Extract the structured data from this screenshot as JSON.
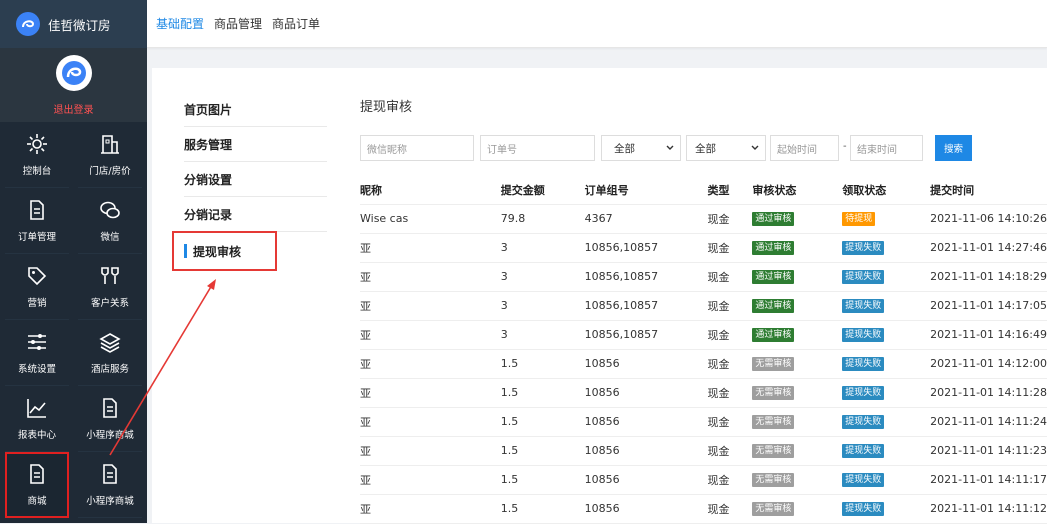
{
  "brand": {
    "name": "佳哲微订房"
  },
  "profile": {
    "logout_label": "退出登录"
  },
  "nav": [
    {
      "label": "控制台",
      "icon": "gear-icon"
    },
    {
      "label": "门店/房价",
      "icon": "building-icon"
    },
    {
      "label": "订单管理",
      "icon": "document-icon"
    },
    {
      "label": "微信",
      "icon": "wechat-icon"
    },
    {
      "label": "营销",
      "icon": "tag-icon"
    },
    {
      "label": "客户关系",
      "icon": "cups-icon"
    },
    {
      "label": "系统设置",
      "icon": "sliders-icon"
    },
    {
      "label": "酒店服务",
      "icon": "layers-icon"
    },
    {
      "label": "报表中心",
      "icon": "chart-icon"
    },
    {
      "label": "小程序商城",
      "icon": "document-icon"
    },
    {
      "label": "商城",
      "icon": "document-icon"
    },
    {
      "label": "小程序商城",
      "icon": "document-icon"
    }
  ],
  "tabs": [
    "基础配置",
    "商品管理",
    "商品订单"
  ],
  "submenu": [
    "首页图片",
    "服务管理",
    "分销设置",
    "分销记录",
    "提现审核"
  ],
  "page_title": "提现审核",
  "filters": {
    "nickname_placeholder": "微信昵称",
    "order_placeholder": "订单号",
    "select1": "全部",
    "select2": "全部",
    "start_placeholder": "起始时间",
    "dash": "-",
    "end_placeholder": "结束时间",
    "search_label": "搜索"
  },
  "table": {
    "headers": [
      "昵称",
      "提交金额",
      "订单组号",
      "类型",
      "审核状态",
      "领取状态",
      "提交时间"
    ],
    "rows": [
      [
        "Wise cas",
        "79.8",
        "4367",
        "现金",
        "通过审核",
        "待提现",
        "2021-11-06 14:10:26"
      ],
      [
        "亚",
        "3",
        "10856,10857",
        "现金",
        "通过审核",
        "提现失败",
        "2021-11-01 14:27:46"
      ],
      [
        "亚",
        "3",
        "10856,10857",
        "现金",
        "通过审核",
        "提现失败",
        "2021-11-01 14:18:29"
      ],
      [
        "亚",
        "3",
        "10856,10857",
        "现金",
        "通过审核",
        "提现失败",
        "2021-11-01 14:17:05"
      ],
      [
        "亚",
        "3",
        "10856,10857",
        "现金",
        "通过审核",
        "提现失败",
        "2021-11-01 14:16:49"
      ],
      [
        "亚",
        "1.5",
        "10856",
        "现金",
        "无需审核",
        "提现失败",
        "2021-11-01 14:12:00"
      ],
      [
        "亚",
        "1.5",
        "10856",
        "现金",
        "无需审核",
        "提现失败",
        "2021-11-01 14:11:28"
      ],
      [
        "亚",
        "1.5",
        "10856",
        "现金",
        "无需审核",
        "提现失败",
        "2021-11-01 14:11:24"
      ],
      [
        "亚",
        "1.5",
        "10856",
        "现金",
        "无需审核",
        "提现失败",
        "2021-11-01 14:11:23"
      ],
      [
        "亚",
        "1.5",
        "10856",
        "现金",
        "无需审核",
        "提现失败",
        "2021-11-01 14:11:17"
      ],
      [
        "亚",
        "1.5",
        "10856",
        "现金",
        "无需审核",
        "提现失败",
        "2021-11-01 14:11:12"
      ]
    ]
  },
  "colors": {
    "accent": "#1e88e5",
    "sidebar": "#1f2a36",
    "highlight": "#e53935"
  }
}
